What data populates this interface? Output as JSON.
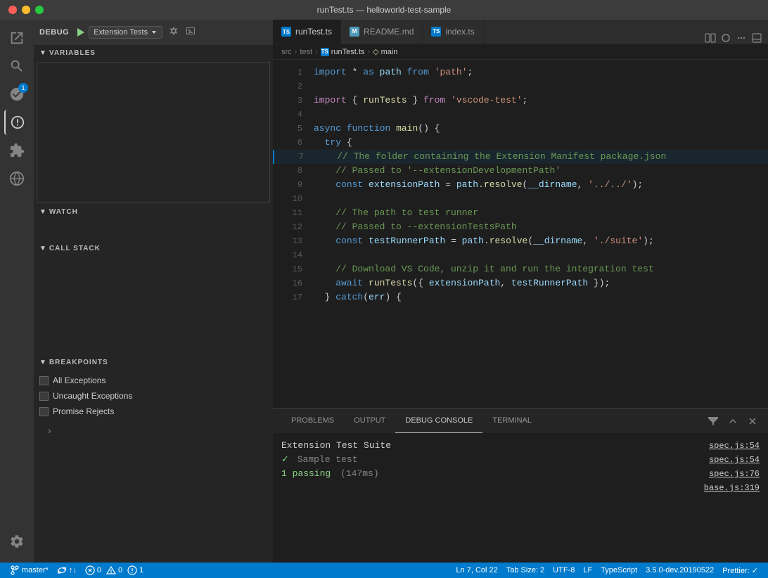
{
  "titleBar": {
    "title": "runTest.ts — helloworld-test-sample"
  },
  "debugToolbar": {
    "debugLabel": "DEBUG",
    "configName": "Extension Tests",
    "runTooltip": "Start Debugging"
  },
  "sections": {
    "variables": "VARIABLES",
    "watch": "WATCH",
    "callStack": "CALL STACK",
    "breakpoints": "BREAKPOINTS"
  },
  "breakpoints": [
    "All Exceptions",
    "Uncaught Exceptions",
    "Promise Rejects"
  ],
  "tabs": [
    {
      "label": "runTest.ts",
      "type": "ts",
      "active": true
    },
    {
      "label": "README.md",
      "type": "md",
      "active": false
    },
    {
      "label": "index.ts",
      "type": "ts",
      "active": false
    }
  ],
  "breadcrumb": {
    "parts": [
      "src",
      "test",
      "runTest.ts",
      "main"
    ]
  },
  "codeLines": [
    {
      "num": "",
      "content": ""
    },
    {
      "num": "1",
      "tokens": [
        {
          "t": "kw",
          "v": "import"
        },
        {
          "t": "punct",
          "v": " * "
        },
        {
          "t": "kw",
          "v": "as"
        },
        {
          "t": "punct",
          "v": " "
        },
        {
          "t": "var",
          "v": "path"
        },
        {
          "t": "punct",
          "v": " "
        },
        {
          "t": "kw",
          "v": "from"
        },
        {
          "t": "punct",
          "v": " "
        },
        {
          "t": "str",
          "v": "'path'"
        },
        {
          "t": "punct",
          "v": ";"
        }
      ]
    },
    {
      "num": "2",
      "tokens": []
    },
    {
      "num": "3",
      "tokens": [
        {
          "t": "import-kw",
          "v": "import"
        },
        {
          "t": "punct",
          "v": " { "
        },
        {
          "t": "fn",
          "v": "runTests"
        },
        {
          "t": "punct",
          "v": " } "
        },
        {
          "t": "import-kw",
          "v": "from"
        },
        {
          "t": "punct",
          "v": " "
        },
        {
          "t": "str",
          "v": "'vscode-test'"
        },
        {
          "t": "punct",
          "v": ";"
        }
      ]
    },
    {
      "num": "4",
      "tokens": []
    },
    {
      "num": "5",
      "tokens": [
        {
          "t": "kw",
          "v": "async"
        },
        {
          "t": "punct",
          "v": " "
        },
        {
          "t": "kw",
          "v": "function"
        },
        {
          "t": "punct",
          "v": " "
        },
        {
          "t": "fn",
          "v": "main"
        },
        {
          "t": "punct",
          "v": "() {"
        }
      ]
    },
    {
      "num": "6",
      "tokens": [
        {
          "t": "punct",
          "v": "  "
        },
        {
          "t": "kw",
          "v": "try"
        },
        {
          "t": "punct",
          "v": " {"
        }
      ]
    },
    {
      "num": "7",
      "tokens": [
        {
          "t": "comment",
          "v": "    // The folder containing the Extension Manifest package.json"
        }
      ]
    },
    {
      "num": "8",
      "tokens": [
        {
          "t": "comment",
          "v": "    // Passed to '--extensionDevelopmentPath'"
        }
      ]
    },
    {
      "num": "9",
      "tokens": [
        {
          "t": "punct",
          "v": "    "
        },
        {
          "t": "kw",
          "v": "const"
        },
        {
          "t": "punct",
          "v": " "
        },
        {
          "t": "var",
          "v": "extensionPath"
        },
        {
          "t": "punct",
          "v": " = "
        },
        {
          "t": "var",
          "v": "path"
        },
        {
          "t": "punct",
          "v": "."
        },
        {
          "t": "fn",
          "v": "resolve"
        },
        {
          "t": "punct",
          "v": "("
        },
        {
          "t": "var",
          "v": "__dirname"
        },
        {
          "t": "punct",
          "v": ", "
        },
        {
          "t": "str",
          "v": "'../../'"
        },
        {
          "t": "punct",
          "v": ");"
        }
      ]
    },
    {
      "num": "10",
      "tokens": []
    },
    {
      "num": "11",
      "tokens": [
        {
          "t": "comment",
          "v": "    // The path to test runner"
        }
      ]
    },
    {
      "num": "12",
      "tokens": [
        {
          "t": "comment",
          "v": "    // Passed to --extensionTestsPath"
        }
      ]
    },
    {
      "num": "13",
      "tokens": [
        {
          "t": "punct",
          "v": "    "
        },
        {
          "t": "kw",
          "v": "const"
        },
        {
          "t": "punct",
          "v": " "
        },
        {
          "t": "var",
          "v": "testRunnerPath"
        },
        {
          "t": "punct",
          "v": " = "
        },
        {
          "t": "var",
          "v": "path"
        },
        {
          "t": "punct",
          "v": "."
        },
        {
          "t": "fn",
          "v": "resolve"
        },
        {
          "t": "punct",
          "v": "("
        },
        {
          "t": "var",
          "v": "__dirname"
        },
        {
          "t": "punct",
          "v": ", "
        },
        {
          "t": "str",
          "v": "'./suite'"
        },
        {
          "t": "punct",
          "v": ");"
        }
      ]
    },
    {
      "num": "14",
      "tokens": []
    },
    {
      "num": "15",
      "tokens": [
        {
          "t": "comment",
          "v": "    // Download VS Code, unzip it and run the integration test"
        }
      ]
    },
    {
      "num": "16",
      "tokens": [
        {
          "t": "punct",
          "v": "    "
        },
        {
          "t": "kw",
          "v": "await"
        },
        {
          "t": "punct",
          "v": " "
        },
        {
          "t": "fn",
          "v": "runTests"
        },
        {
          "t": "punct",
          "v": "({ "
        },
        {
          "t": "var",
          "v": "extensionPath"
        },
        {
          "t": "punct",
          "v": ", "
        },
        {
          "t": "var",
          "v": "testRunnerPath"
        },
        {
          "t": "punct",
          "v": " });"
        }
      ]
    },
    {
      "num": "17",
      "tokens": [
        {
          "t": "punct",
          "v": "  } "
        },
        {
          "t": "kw",
          "v": "catch"
        },
        {
          "t": "punct",
          "v": "("
        },
        {
          "t": "var",
          "v": "err"
        },
        {
          "t": "punct",
          "v": ") {"
        }
      ]
    }
  ],
  "panelTabs": [
    "PROBLEMS",
    "OUTPUT",
    "DEBUG CONSOLE",
    "TERMINAL"
  ],
  "activePanelTab": "DEBUG CONSOLE",
  "console": {
    "suiteName": "Extension Test Suite",
    "checkMark": "✓",
    "testName": "Sample test",
    "passingText": "1 passing",
    "durationText": "(147ms)"
  },
  "consoleLinks": [
    "spec.js:54",
    "spec.js:54",
    "spec.js:76",
    "base.js:319"
  ],
  "statusBar": {
    "branch": "master*",
    "syncIcon": "↑↓",
    "errors": "0",
    "warnings": "0",
    "info": "1",
    "position": "Ln 7, Col 22",
    "tabSize": "Tab Size: 2",
    "encoding": "UTF-8",
    "lineEnding": "LF",
    "language": "TypeScript",
    "version": "3.5.0-dev.20190522",
    "prettier": "Prettier: ✓"
  }
}
